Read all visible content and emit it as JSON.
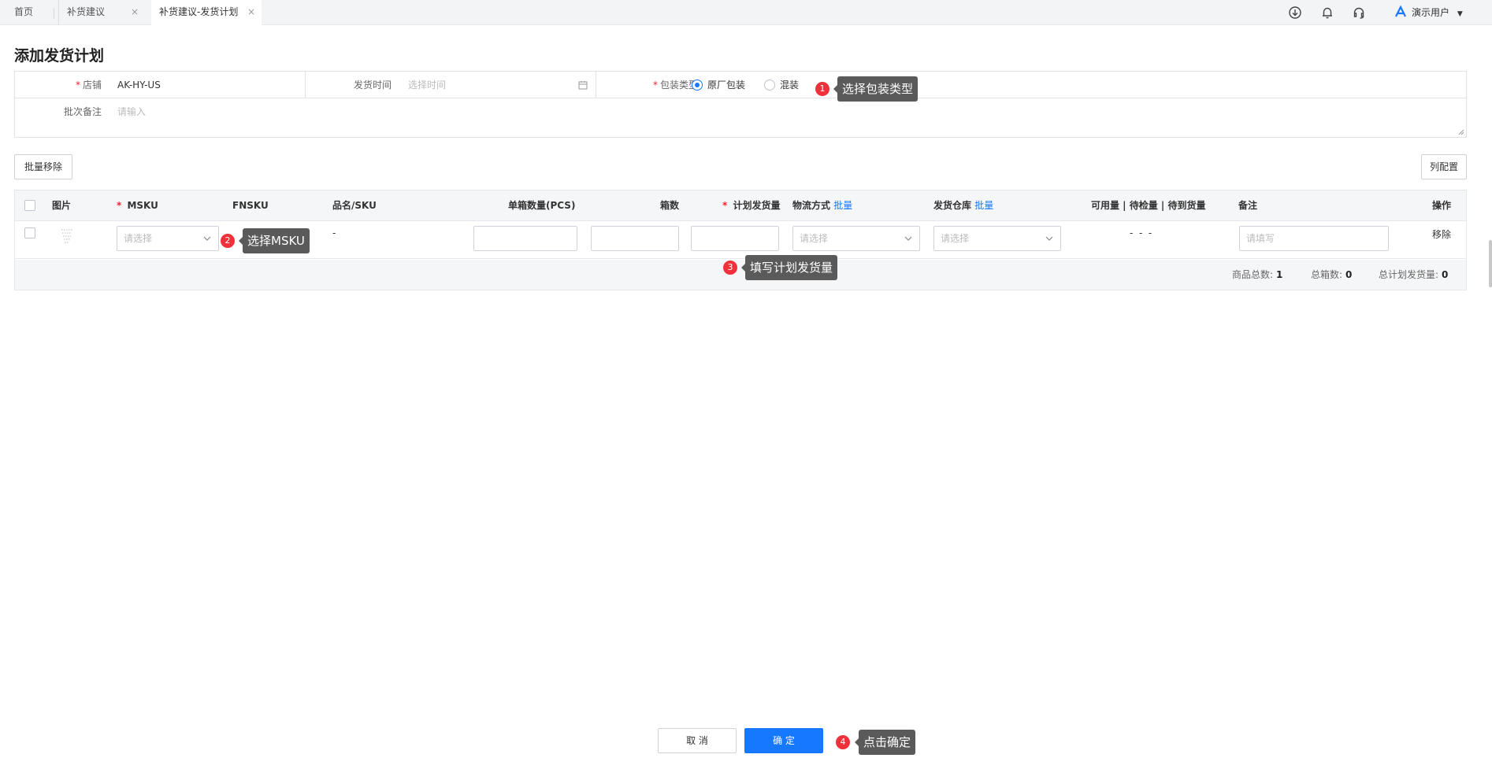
{
  "tabs": {
    "home": "首页",
    "tab1": "补货建议",
    "tab2": "补货建议-发货计划",
    "close": "×"
  },
  "header": {
    "user": "演示用户",
    "icons": [
      "download-icon",
      "bell-icon",
      "headset-icon"
    ]
  },
  "page_title": "添加发货计划",
  "form": {
    "shop_label": "店铺",
    "shop_value": "AK-HY-US",
    "ship_time_label": "发货时间",
    "ship_time_placeholder": "选择时间",
    "pack_type_label": "包装类型",
    "pack_options": [
      "原厂包装",
      "混装"
    ],
    "pack_selected": "原厂包装",
    "remark_label": "批次备注",
    "remark_placeholder": "请输入"
  },
  "toolbar": {
    "batch_remove": "批量移除",
    "column_config": "列配置"
  },
  "table": {
    "headers": {
      "image": "图片",
      "msku": "MSKU",
      "fnsku": "FNSKU",
      "name_sku": "品名/SKU",
      "pcs_per_box": "单箱数量(PCS)",
      "boxes": "箱数",
      "planned_qty": "计划发货量",
      "logistics": "物流方式",
      "warehouse": "发货仓库",
      "batch_link": "批量",
      "stock": "可用量 | 待检量 | 待到货量",
      "remark": "备注",
      "action": "操作"
    },
    "row": {
      "msku_placeholder": "请选择",
      "name_sku": "-",
      "logistics_placeholder": "请选择",
      "warehouse_placeholder": "请选择",
      "stock_values": "-  -  -",
      "remark_placeholder": "请填写",
      "remove": "移除"
    },
    "footer": {
      "total_products_label": "商品总数:",
      "total_products": "1",
      "total_boxes_label": "总箱数:",
      "total_boxes": "0",
      "total_planned_label": "总计划发货量:",
      "total_planned": "0"
    }
  },
  "footer_buttons": {
    "cancel": "取 消",
    "confirm": "确 定"
  },
  "annotations": [
    {
      "num": "1",
      "text": "选择包装类型"
    },
    {
      "num": "2",
      "text": "选择MSKU"
    },
    {
      "num": "3",
      "text": "填写计划发货量"
    },
    {
      "num": "4",
      "text": "点击确定"
    }
  ],
  "colors": {
    "primary": "#1677ff",
    "required": "#f5222d",
    "badge": "#f0303a",
    "tooltip": "#5a5a5a"
  }
}
